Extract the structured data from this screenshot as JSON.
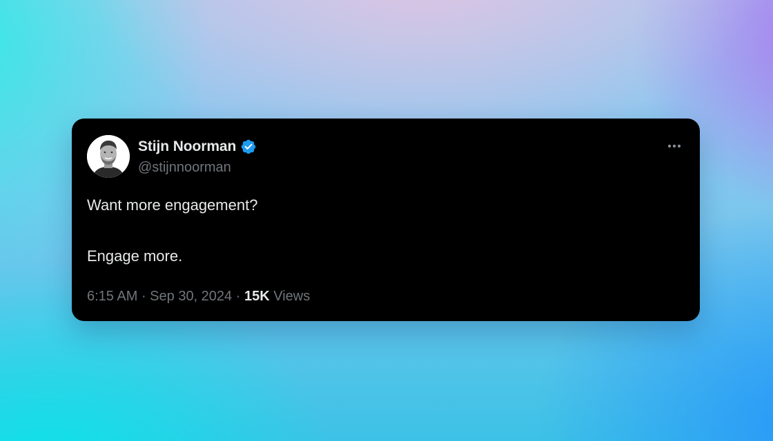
{
  "tweet": {
    "author": {
      "display_name": "Stijn Noorman",
      "handle": "@stijnnoorman",
      "verified": true,
      "verified_badge_icon": "verified-badge-icon",
      "verified_color": "#1d9bf0",
      "avatar": "avatar-photo"
    },
    "more_icon": "more-horizontal-icon",
    "text": {
      "line1": "Want more engagement?",
      "line2": "Engage more."
    },
    "meta": {
      "time": "6:15 AM",
      "separator": " · ",
      "date": "Sep 30, 2024",
      "views_count": "15K",
      "views_label": "Views"
    }
  },
  "colors": {
    "card_background": "#000000",
    "primary_text": "#e7e9ea",
    "secondary_text": "#71767b",
    "accent": "#1d9bf0"
  }
}
